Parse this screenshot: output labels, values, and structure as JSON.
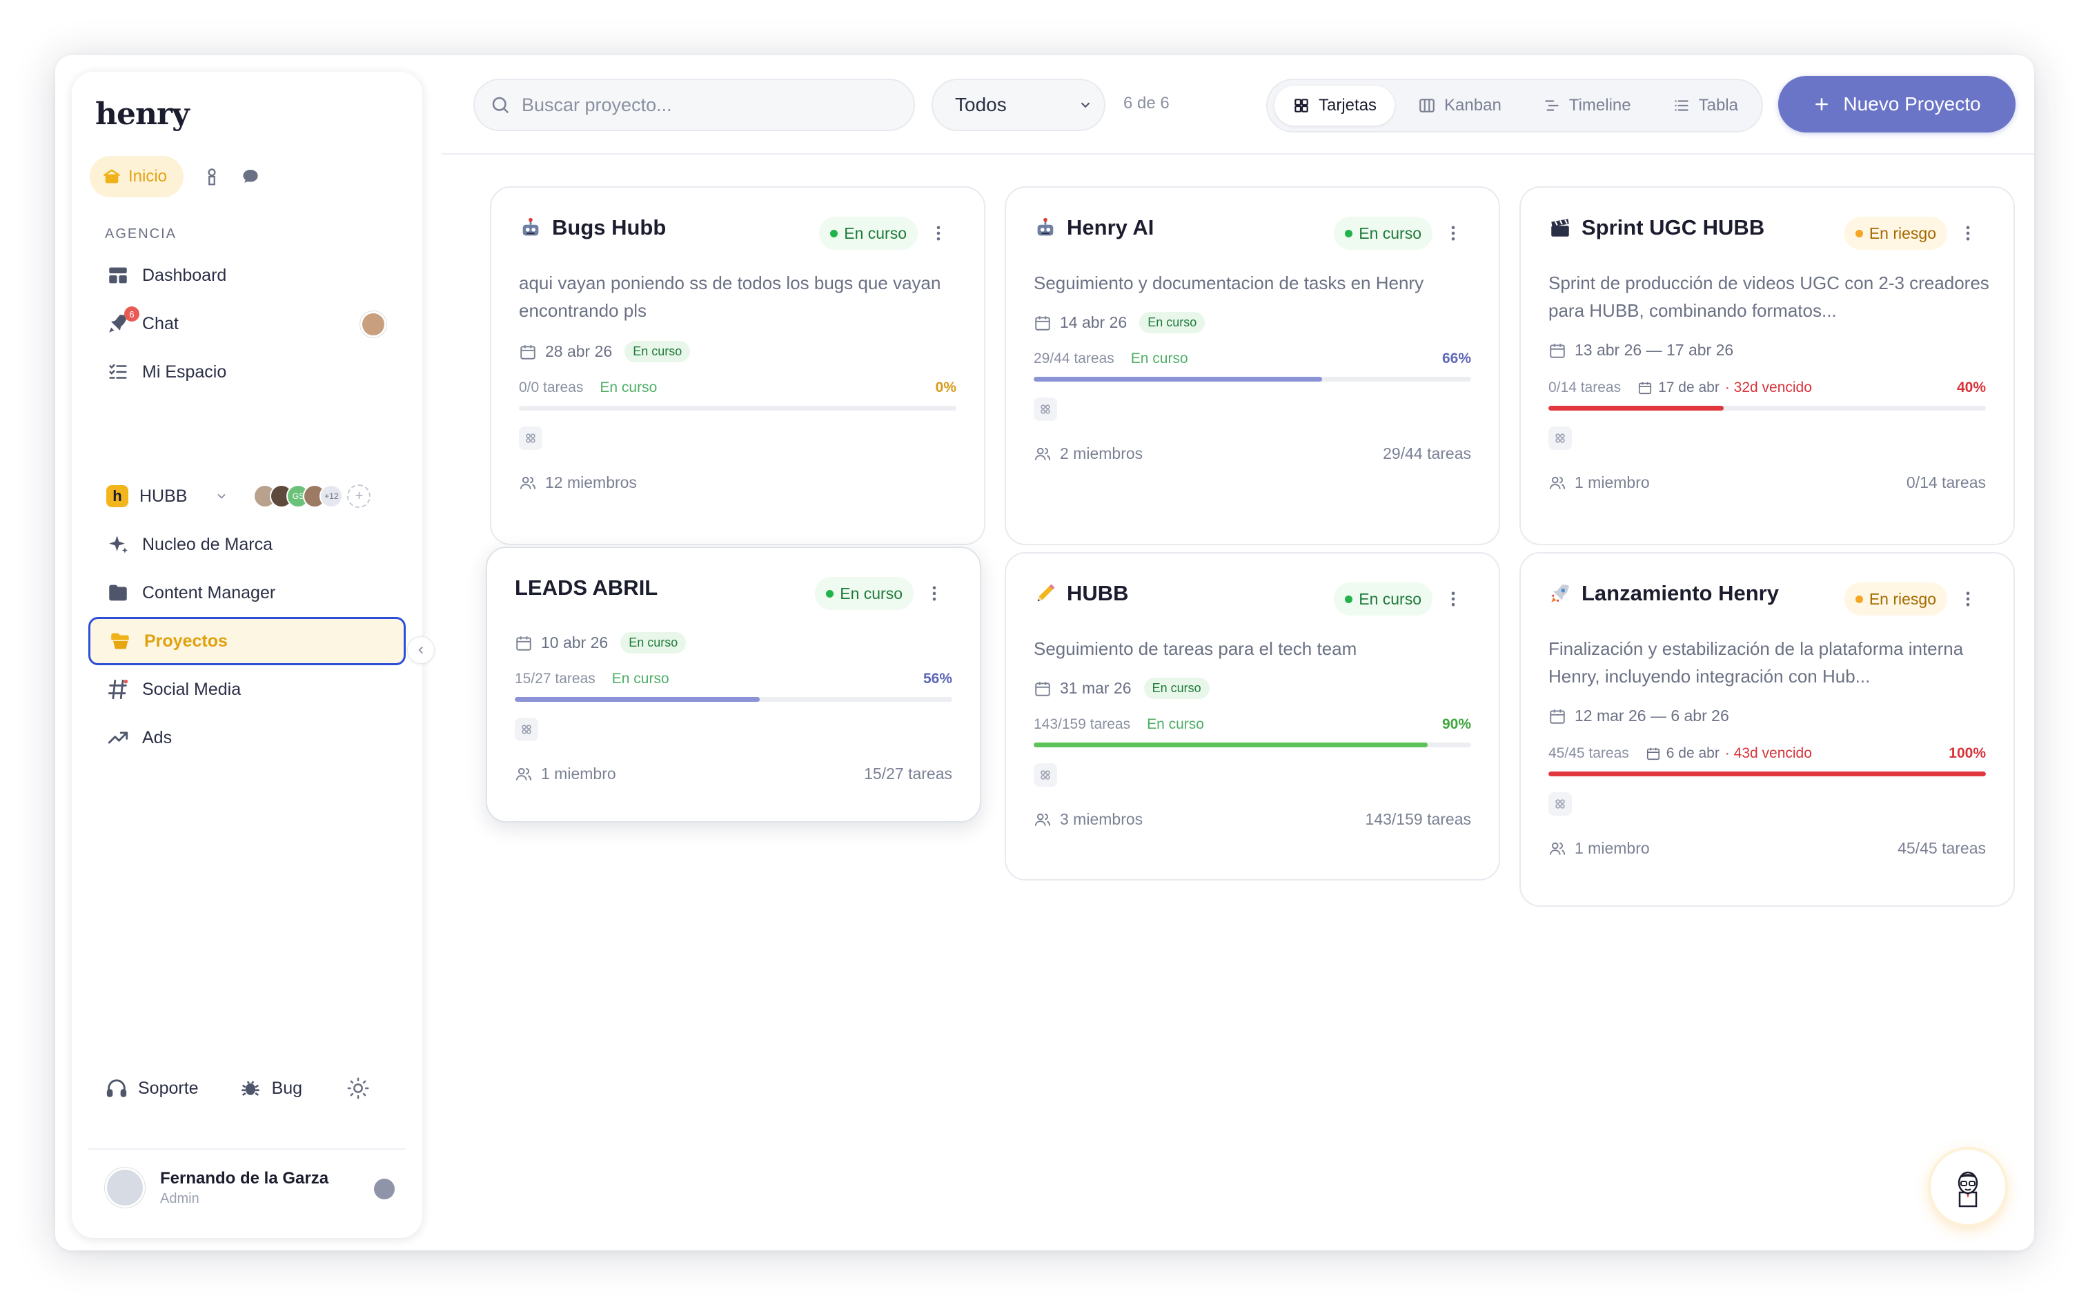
{
  "app": {
    "logo": "henry"
  },
  "sidebar": {
    "home_label": "Inicio",
    "section_label": "AGENCIA",
    "nav": [
      {
        "label": "Dashboard",
        "icon": "dashboard-icon"
      },
      {
        "label": "Chat",
        "icon": "rocket-icon",
        "badge": "6"
      },
      {
        "label": "Mi Espacio",
        "icon": "checklist-icon"
      }
    ],
    "workspace": {
      "name": "HUBB",
      "logo_letter": "h",
      "member_initials": "GS",
      "more_members": "+12"
    },
    "workspace_nav": [
      {
        "label": "Nucleo de Marca",
        "icon": "sparkle-icon"
      },
      {
        "label": "Content Manager",
        "icon": "folder-icon"
      },
      {
        "label": "Proyectos",
        "icon": "folder-stack-icon",
        "active": true
      },
      {
        "label": "Social Media",
        "icon": "hashtag-icon"
      },
      {
        "label": "Ads",
        "icon": "trend-up-icon"
      }
    ],
    "support_label": "Soporte",
    "bug_label": "Bug",
    "user": {
      "name": "Fernando de la Garza",
      "role": "Admin"
    }
  },
  "toolbar": {
    "search_placeholder": "Buscar proyecto...",
    "filter_value": "Todos",
    "count": "6 de 6",
    "views": [
      "Tarjetas",
      "Kanban",
      "Timeline",
      "Tabla"
    ],
    "active_view": "Tarjetas",
    "new_button": "Nuevo Proyecto"
  },
  "colors": {
    "accent": "#6a75c7",
    "active_nav": "#f0b21a",
    "progress_purple": "#8b93d6",
    "progress_green": "#5cc35a",
    "progress_red": "#e0383e"
  },
  "projects": [
    {
      "title": "Bugs Hubb",
      "emoji": "robot-icon",
      "status": "En curso",
      "status_color": "green",
      "description": "aqui vayan poniendo ss de todos los bugs que vayan encontrando pls",
      "date": "28 abr 26",
      "date_badge": "En curso",
      "tasks": "0/0 tareas",
      "task_status": "En curso",
      "pct": "0%",
      "progress": 0,
      "bar_color": "#8b93d6",
      "pct_color": "#d99a1a",
      "members": "12 miembros",
      "tasks_right": ""
    },
    {
      "title": "Henry AI",
      "emoji": "robot-icon",
      "status": "En curso",
      "status_color": "green",
      "description": "Seguimiento y documentacion de tasks en Henry",
      "date": "14 abr 26",
      "date_badge": "En curso",
      "tasks": "29/44 tareas",
      "task_status": "En curso",
      "pct": "66%",
      "progress": 0.66,
      "bar_color": "#8b93d6",
      "pct_color": "#5e67b8",
      "members": "2 miembros",
      "tasks_right": "29/44 tareas"
    },
    {
      "title": "Sprint UGC HUBB",
      "emoji": "clapper-icon",
      "status": "En riesgo",
      "status_color": "orange",
      "description": "Sprint de producción de videos UGC con 2-3 creadores para HUBB, combinando formatos...",
      "date": "13 abr 26 — 17 abr 26",
      "tasks": "0/14 tareas",
      "due": "17 de abr",
      "late": "· 32d vencido",
      "pct": "40%",
      "progress": 0.4,
      "bar_color": "#e0383e",
      "pct_color": "#d8333a",
      "members": "1 miembro",
      "tasks_right": "0/14 tareas"
    },
    {
      "title": "LEADS ABRIL",
      "emoji": "",
      "status": "En curso",
      "status_color": "green",
      "description": "",
      "date": "10 abr 26",
      "date_badge": "En curso",
      "tasks": "15/27 tareas",
      "task_status": "En curso",
      "pct": "56%",
      "progress": 0.56,
      "bar_color": "#8b93d6",
      "pct_color": "#5e67b8",
      "members": "1 miembro",
      "tasks_right": "15/27 tareas"
    },
    {
      "title": "HUBB",
      "emoji": "pencil-icon",
      "status": "En curso",
      "status_color": "green",
      "description": "Seguimiento de tareas para el tech team",
      "date": "31 mar 26",
      "date_badge": "En curso",
      "tasks": "143/159 tareas",
      "task_status": "En curso",
      "pct": "90%",
      "progress": 0.9,
      "bar_color": "#5cc35a",
      "pct_color": "#3fa63e",
      "members": "3 miembros",
      "tasks_right": "143/159 tareas"
    },
    {
      "title": "Lanzamiento Henry",
      "emoji": "rocket-icon",
      "status": "En riesgo",
      "status_color": "orange",
      "description": "Finalización y estabilización de la plataforma interna Henry, incluyendo integración con Hub...",
      "date": "12 mar 26 — 6 abr 26",
      "tasks": "45/45 tareas",
      "due": "6 de abr",
      "late": "· 43d vencido",
      "pct": "100%",
      "progress": 1.0,
      "bar_color": "#e0383e",
      "pct_color": "#d8333a",
      "members": "1 miembro",
      "tasks_right": "45/45 tareas"
    }
  ]
}
